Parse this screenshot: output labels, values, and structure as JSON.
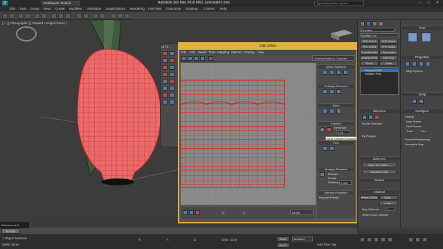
{
  "app": {
    "title": "Autodesk 3ds Max 2016    MK2_Grenade02.max",
    "workspace": "Workspace: Default",
    "search_placeholder": "Type a keyword or phrase",
    "menu": [
      "Edit",
      "Tools",
      "Group",
      "Views",
      "Create",
      "Modifiers",
      "Animation",
      "Graph Editors",
      "Rendering",
      "Civil View",
      "Customize",
      "Scripting",
      "Content",
      "Help"
    ]
  },
  "viewport": {
    "label": "[ + ] [ Orthographic ] [ Shaded + Edged Faces ]"
  },
  "floating_bar": {
    "title": "Lit Fil..."
  },
  "uv_editor": {
    "title": "Edit UVWs",
    "menu": [
      "File",
      "Edit",
      "Select",
      "Tools",
      "Mapping",
      "Options",
      "Display",
      "View"
    ],
    "map_dropdown": "CheckerPattern ( Checker )",
    "sections": {
      "quick_transform": "Quick Transform",
      "reshape": "Reshape Elements",
      "stitch": "Stitch",
      "explode": "Explode",
      "threshold_label": "Threshold",
      "threshold_value": "0.01",
      "weld": "Weld",
      "peel": "Peel",
      "arrange": "Arrange Elements",
      "rescale": "Rescale",
      "rotate": "Rotate",
      "padding_label": "Padding:",
      "padding_value": "0.002",
      "element_props": "Element Properties",
      "rescale_priority": "Rescale Priority:"
    },
    "bottom": {
      "coord_u": "U:",
      "coord_v": "V:",
      "grid": "All IDs"
    }
  },
  "tooltip": "Weld Selected Subobjects",
  "command_panel": {
    "object_name": "Grenade",
    "modifier_list": "Modifier List",
    "buttons": [
      "FFD 2x2x2",
      "FFD Select",
      "FFD 3x3x3",
      "FFD 4x4x4",
      "TurboSmooth",
      "Symmetry",
      "Unwrap UVW",
      "Edit Poly",
      "Push",
      "Shell"
    ],
    "stack": [
      "Unwrap UVW",
      "Editable Poly"
    ],
    "selection_head": "Selection",
    "modify_selection": "Modify Selection",
    "by_polygon": "By Polygon",
    "edit_uvs_head": "Edit UVs",
    "open_uv_editor": "Open UV Editor ...",
    "tweak_in_view": "Tweak In View",
    "seams_head": "Seams",
    "channel_head": "Channel",
    "reset_uvws": "Reset UVWs",
    "save": "Save...",
    "load": "Load...",
    "map_channel": "Map Channel:",
    "map_channel_value": "1",
    "vertex_color": "Vertex Color Channel"
  },
  "right_panel": {
    "peel_head": "Peel",
    "projection_head": "Projection",
    "align_options": "Align Options",
    "wrap_head": "Wrap",
    "configure_head": "Configure",
    "display_label": "Display",
    "map_seams": "Map Seams",
    "peel_seams": "Peel Seams",
    "thick": "Thick",
    "thin": "Thin",
    "prevent_reflattening": "Prevent Reflattening",
    "normalize_map": "Normalize Map"
  },
  "timeline": {
    "frame": "0 / 100"
  },
  "status": {
    "selected": "1 Object Selected",
    "hint": "Select faces",
    "x_label": "X:",
    "y_label": "Y:",
    "z_label": "Z:",
    "grid": "Grid = 10.0",
    "auto": "Auto",
    "set_key": "Set K.",
    "selected_mode": "Selected",
    "add_time_tag": "Add Time Tag",
    "welcome": "Welcome to M"
  },
  "colors": {
    "accent": "#e1b042",
    "wire": "#e02020",
    "mesh_fill": "#e86a6a",
    "canvas": "#8a8a8a"
  }
}
